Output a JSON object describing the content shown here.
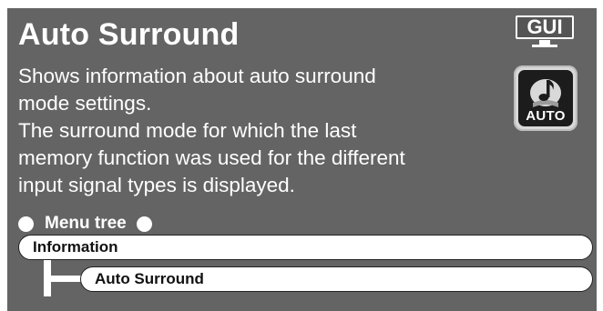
{
  "page": {
    "title": "Auto Surround",
    "description_lines": [
      "Shows information about auto surround",
      "mode settings.",
      "The surround mode for which the last",
      "memory function was used for the different",
      "input signal types is displayed."
    ]
  },
  "badges": {
    "gui_label": "GUI",
    "auto_label": "AUTO",
    "auto_icon": "auto-surround-icon"
  },
  "menu_tree": {
    "header": "Menu tree",
    "items": [
      {
        "label": "Information",
        "level": 0
      },
      {
        "label": "Auto Surround",
        "level": 1
      }
    ]
  },
  "colors": {
    "panel_background": "#646464",
    "text": "#ffffff",
    "bar_background": "#ffffff"
  }
}
